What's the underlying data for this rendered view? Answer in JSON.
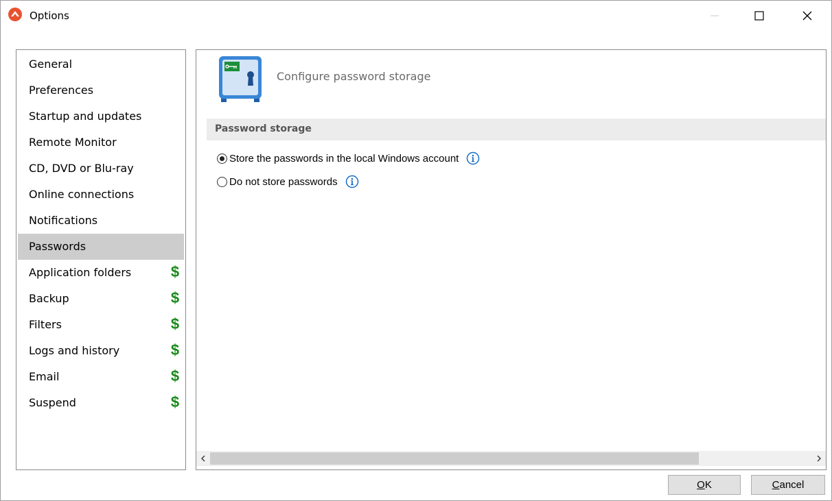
{
  "window": {
    "title": "Options",
    "controls": {
      "minimize": "minimize",
      "maximize": "maximize",
      "close": "close"
    }
  },
  "sidebar": {
    "selected": "Passwords",
    "items": [
      {
        "label": "General",
        "premium": false
      },
      {
        "label": "Preferences",
        "premium": false
      },
      {
        "label": "Startup and updates",
        "premium": false
      },
      {
        "label": "Remote Monitor",
        "premium": false
      },
      {
        "label": "CD, DVD or Blu-ray",
        "premium": false
      },
      {
        "label": "Online connections",
        "premium": false
      },
      {
        "label": "Notifications",
        "premium": false
      },
      {
        "label": "Passwords",
        "premium": false
      },
      {
        "label": "Application folders",
        "premium": true
      },
      {
        "label": "Backup",
        "premium": true
      },
      {
        "label": "Filters",
        "premium": true
      },
      {
        "label": "Logs and history",
        "premium": true
      },
      {
        "label": "Email",
        "premium": true
      },
      {
        "label": "Suspend",
        "premium": true
      }
    ]
  },
  "page": {
    "header": "Configure password storage",
    "header_icon": "password-safe-icon",
    "section": "Password storage",
    "options": [
      {
        "label": "Store the passwords in the local Windows account",
        "checked": true
      },
      {
        "label": "Do not store passwords",
        "checked": false
      }
    ]
  },
  "buttons": {
    "ok": {
      "accel": "O",
      "rest": "K"
    },
    "cancel": {
      "accel": "C",
      "rest": "ancel"
    }
  },
  "colors": {
    "premium_dollar": "#1a8a1a",
    "info_icon": "#1a6fc4",
    "selected_bg": "#cdcdcd",
    "app_icon": "#e8532f"
  }
}
